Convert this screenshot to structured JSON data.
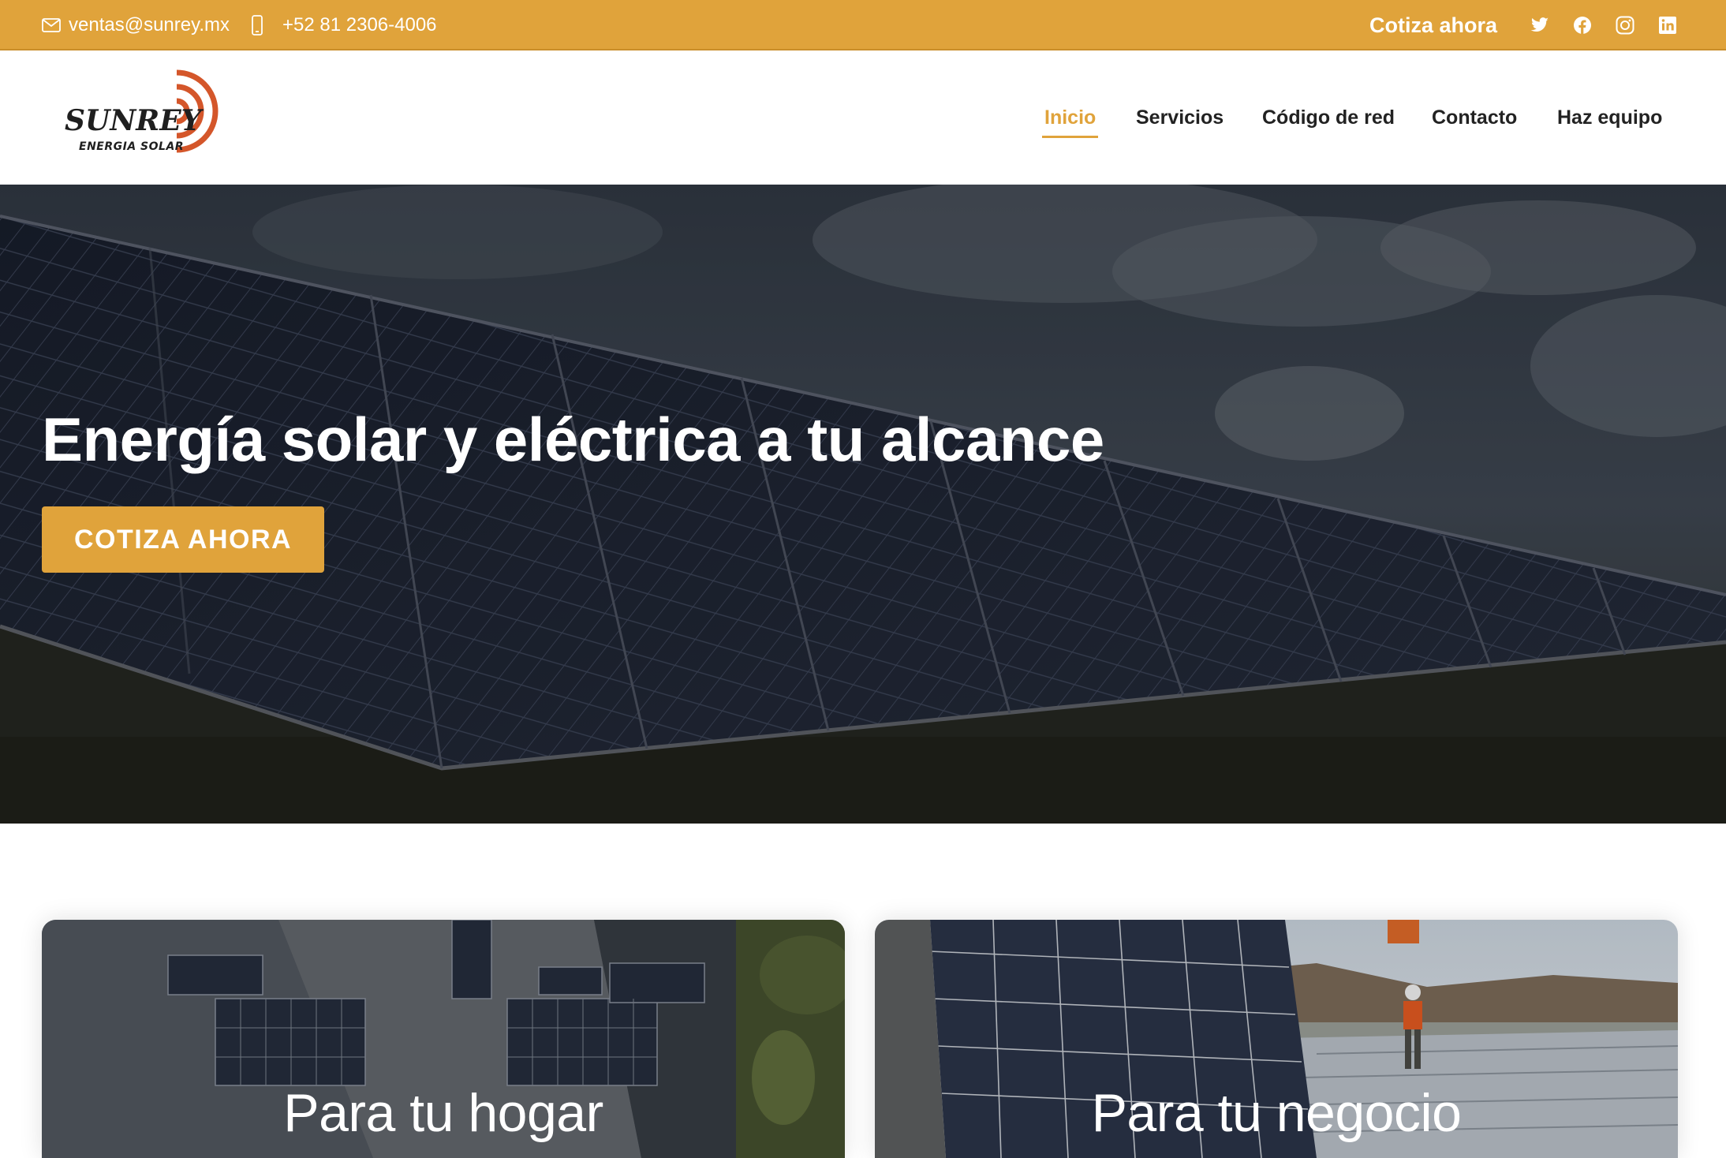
{
  "topbar": {
    "email": "ventas@sunrey.mx",
    "phone": "+52 81 2306-4006",
    "cta_label": "Cotiza ahora",
    "social_icons": [
      "twitter-icon",
      "facebook-icon",
      "instagram-icon",
      "linkedin-icon"
    ]
  },
  "logo": {
    "name": "SUNREY",
    "tagline": "ENERGIA SOLAR"
  },
  "nav": {
    "items": [
      {
        "label": "Inicio",
        "active": true
      },
      {
        "label": "Servicios",
        "active": false
      },
      {
        "label": "Código de red",
        "active": false
      },
      {
        "label": "Contacto",
        "active": false
      },
      {
        "label": "Haz equipo",
        "active": false
      }
    ]
  },
  "hero": {
    "title": "Energía solar y eléctrica a tu alcance",
    "button_label": "COTIZA AHORA"
  },
  "cards": [
    {
      "title": "Para tu hogar"
    },
    {
      "title": "Para tu negocio"
    }
  ],
  "colors": {
    "accent": "#e0a33b",
    "logo_orange": "#d4562a",
    "nav_text": "#222222"
  }
}
